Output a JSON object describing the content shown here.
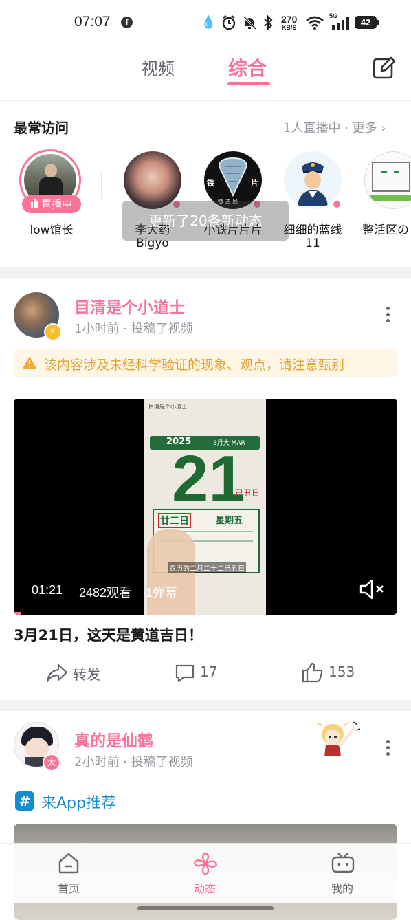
{
  "status_bar": {
    "time": "07:07",
    "app_icon": "facebook-icon",
    "net_speed_value": "270",
    "net_speed_unit": "KB/S",
    "network": "5G",
    "battery": "42"
  },
  "top_tabs": {
    "video": "视频",
    "all": "综合",
    "edit_icon": "edit-icon"
  },
  "most_visited": {
    "title": "最常访问",
    "more": "1人直播中 · 更多 ›",
    "live_badge": "直播中",
    "users": [
      {
        "name": "low馆长",
        "name2": ""
      },
      {
        "name": "李大药",
        "name2": "Bigyo"
      },
      {
        "name": "小铁片片片",
        "name2": ""
      },
      {
        "name": "细细的蓝线",
        "name2": "11"
      },
      {
        "name": "整活区の",
        "name2": ""
      }
    ],
    "avatar_text": {
      "logo_left": "铁",
      "logo_right": "片",
      "logo_bottom": "铸 造 局"
    },
    "toast": "更新了20条新动态"
  },
  "post1": {
    "author": "目清是个小道士",
    "meta": "1小时前 · 投稿了视频",
    "warning": "该内容涉及未经科学验证的现象、观点，请注意甄别",
    "video": {
      "duration": "01:21",
      "views": "2482观看",
      "danmaku": "1弹幕",
      "frame_year": "2025",
      "frame_month": "3月大 MAR",
      "frame_day": "21",
      "frame_ganzhi": "己丑日",
      "frame_lunar": "廿二日",
      "frame_weekday": "星期五",
      "frame_caption": "农历的二月二十二己丑日",
      "frame_watermark": "目清是个小道士"
    },
    "title": "3月21日，这天是黄道吉日！",
    "actions": {
      "share": "转发",
      "comments": "17",
      "likes": "153"
    }
  },
  "post2": {
    "author": "真的是仙鹤",
    "meta": "2小时前 · 投稿了视频",
    "avatar_badge": "大",
    "topic_icon": "#",
    "topic": "来App推荐"
  },
  "bottom_nav": {
    "home": "首页",
    "dynamic": "动态",
    "mine": "我的"
  },
  "colors": {
    "accent": "#fb7299",
    "warning_text": "#e0a135",
    "topic_blue": "#178bcf"
  }
}
